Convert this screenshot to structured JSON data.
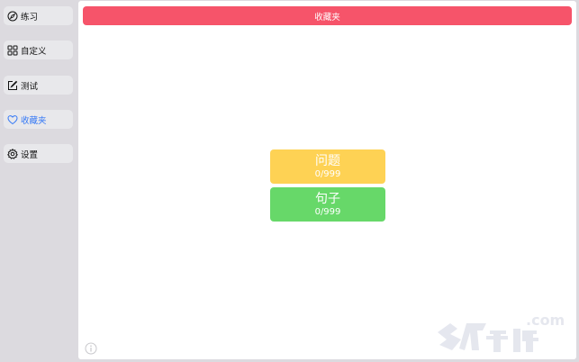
{
  "sidebar": {
    "items": [
      {
        "label": "练习",
        "icon": "compass-icon",
        "active": false
      },
      {
        "label": "自定义",
        "icon": "grid-icon",
        "active": false
      },
      {
        "label": "测试",
        "icon": "edit-icon",
        "active": false
      },
      {
        "label": "收藏夹",
        "icon": "heart-icon",
        "active": true
      },
      {
        "label": "设置",
        "icon": "gear-icon",
        "active": false
      }
    ]
  },
  "header": {
    "title": "收藏夹"
  },
  "cards": [
    {
      "title": "问题",
      "count": "0/999",
      "color": "#fed254"
    },
    {
      "title": "句子",
      "count": "0/999",
      "color": "#67d869"
    }
  ],
  "colors": {
    "accent": "#f6546a",
    "active_text": "#3478f6"
  },
  "watermark": {
    "text_domain": ".com",
    "text_brand": "冬瓜手游"
  }
}
